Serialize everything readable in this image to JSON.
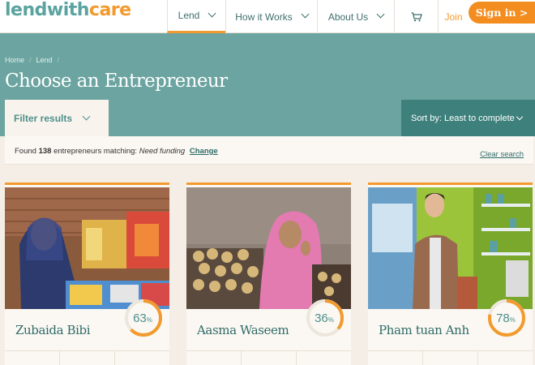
{
  "header": {
    "logo_part1": "lendwith",
    "logo_part2": "care",
    "nav": {
      "lend": "Lend",
      "how": "How it Works",
      "about": "About Us",
      "join": "Join",
      "signin": "Sign in >"
    }
  },
  "breadcrumb": {
    "home": "Home",
    "current": "Lend",
    "sep": "/"
  },
  "page_title": "Choose an Entrepreneur",
  "filter": {
    "label": "Filter results"
  },
  "sort": {
    "label": "Sort by: Least to complete"
  },
  "results": {
    "prefix": "Found",
    "count": "138",
    "middle": "entrepreneurs matching:",
    "criteria": "Need funding",
    "change": "Change",
    "clear": "Clear search"
  },
  "cards": [
    {
      "name": "Zubaida Bibi",
      "percent": 63,
      "percent_text": "63",
      "unit": "%"
    },
    {
      "name": "Aasma Waseem",
      "percent": 36,
      "percent_text": "36",
      "unit": "%"
    },
    {
      "name": "Pham tuan Anh",
      "percent": 78,
      "percent_text": "78",
      "unit": "%"
    }
  ],
  "colors": {
    "teal": "#6ba4a0",
    "teal_dark": "#3d807c",
    "orange": "#f29a2e",
    "cream": "#f5eee6"
  }
}
